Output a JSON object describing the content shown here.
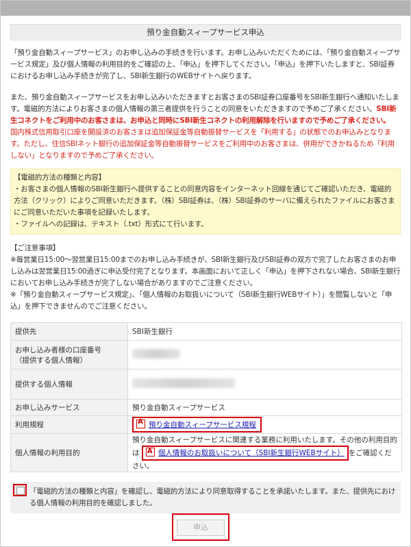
{
  "title": "預り金自動スィープサービス申込",
  "intro": {
    "para1": "「預り金自動スィープサービス」のお申し込みの手続きを行います。お申し込みいただくためには、「預り金自動スィープサービス規定」及び個人情報の利用目的をご確認の上、「申込」を押下してください。「申込」を押下いたしますと、SBI証券におけるお申し込み手続きが完了し、SBI新生銀行のWEBサイトへ戻ります。",
    "para2_black": "また、預り金自動スィープサービスをお申し込みいただきますとお客さまのSBI証券口座番号をSBI新生銀行へ通知いたします。電磁的方法によりお客さまの個人情報の第三者提供を行うことの同意をいただきますので予めご了承ください。",
    "para2_red1": "SBI新生コネクトをご利用中のお客さまは、お申込と同時にSBI新生コネクトの利用解除を行いますので予めご了承ください。",
    "para2_red2": "国内株式信用取引口座を開設済のお客さまは追加保証金等自動振替サービスを「利用する」の状態でのお申込みとなります。ただし、住信SBIネット銀行の追加保証金等自動振替サービスをご利用中のお客さまは、併用ができかねるため「利用しない」となりますので予めご了承ください。"
  },
  "electronic": {
    "heading": "【電磁的方法の種類と内容】",
    "line1": "・お客さまの個人情報のSBI新生銀行へ提供することの同意内容をインターネット回線を通じてご確認いただき、電磁的方法（クリック）によりご同意いただきます。（株）SBI証券は、（株）SBI証券のサーバに備えられたファイルにお客さまにご同意いただいた事項を記録いたします。",
    "line2": "・ファイルへの記録は、テキスト（.txt）形式にて行います。"
  },
  "notes": {
    "heading": "【ご注意事項】",
    "line1": "※毎営業日15:00～翌営業日15:00までのお申し込み手続きが、SBI新生銀行及びSBI証券の双方で完了したお客さまのお申し込みは翌営業日15:00過ぎに申込受付完了となります。本画面において正しく「申込」を押下されない場合、SBI新生銀行においてお申し込み手続きが完了しない場合がありますのでご注意ください。",
    "line2": "※「預り金自動スィープサービス規定」、「個人情報のお取扱いについて（SBI新生銀行WEBサイト）」を閲覧しないと「申込」を押下できませんのでご注意ください。"
  },
  "table": {
    "provider_label": "提供先",
    "provider_value": "SBI新生銀行",
    "account_label_1": "お申し込み者様の口座番号",
    "account_label_2": "（提供する個人情報）",
    "personal_label": "提供する個人情報",
    "service_label": "お申し込みサービス",
    "service_value": "預り金自動スィープサービス",
    "terms_label": "利用規程",
    "terms_link": "預り金自動スィープサービス規程",
    "purpose_label": "個人情報の利用目的",
    "purpose_text_1": "預り金自動スィープサービスに関連する業務に利用いたします。その他の利用目的は",
    "purpose_link": "個人情報のお取扱いについて（SBI新生銀行WEBサイト）",
    "purpose_text_2": "をご確認ください。"
  },
  "consent": {
    "text": "「電磁的方法の種類と内容」を確認し、電磁的方法により同意取得することを承諾いたします。また、提供先における個人情報の利用目的を確認しました。"
  },
  "submit_label": "申込",
  "icons": {
    "pdf": "pdf-icon",
    "checkbox": "checkbox-icon"
  }
}
